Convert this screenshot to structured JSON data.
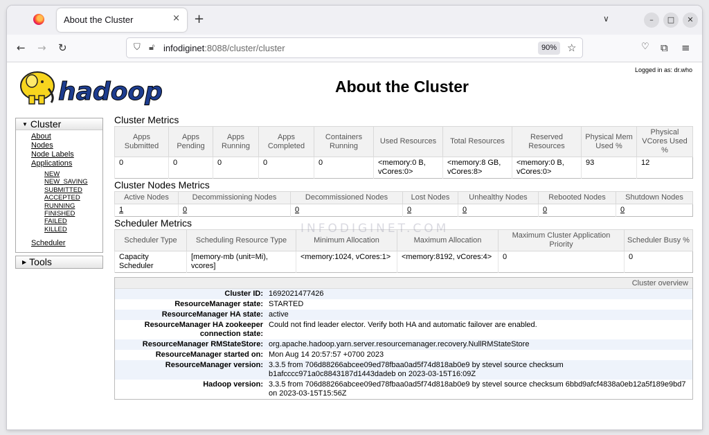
{
  "browser": {
    "tab_title": "About the Cluster",
    "tab_close": "×",
    "new_tab": "+",
    "tab_list": "∨",
    "win_minimize": "–",
    "win_maximize": "□",
    "win_close": "✕",
    "url_host": "infodiginet",
    "url_path": ":8088/cluster/cluster",
    "zoom": "90%"
  },
  "header": {
    "logo_text": "hadoop",
    "title": "About the Cluster",
    "logged_in": "Logged in as: dr.who"
  },
  "sidebar": {
    "cluster_label": "Cluster",
    "links": [
      "About",
      "Nodes",
      "Node Labels",
      "Applications"
    ],
    "app_states": [
      "NEW",
      "NEW_SAVING",
      "SUBMITTED",
      "ACCEPTED",
      "RUNNING",
      "FINISHED",
      "FAILED",
      "KILLED"
    ],
    "scheduler": "Scheduler",
    "tools_label": "Tools"
  },
  "cluster_metrics": {
    "title": "Cluster Metrics",
    "headers": [
      "Apps Submitted",
      "Apps Pending",
      "Apps Running",
      "Apps Completed",
      "Containers Running",
      "Used Resources",
      "Total Resources",
      "Reserved Resources",
      "Physical Mem Used %",
      "Physical VCores Used %"
    ],
    "values": [
      "0",
      "0",
      "0",
      "0",
      "0",
      "<memory:0 B, vCores:0>",
      "<memory:8 GB, vCores:8>",
      "<memory:0 B, vCores:0>",
      "93",
      "12"
    ]
  },
  "node_metrics": {
    "title": "Cluster Nodes Metrics",
    "headers": [
      "Active Nodes",
      "Decommissioning Nodes",
      "Decommissioned Nodes",
      "Lost Nodes",
      "Unhealthy Nodes",
      "Rebooted Nodes",
      "Shutdown Nodes"
    ],
    "values": [
      "1",
      "0",
      "0",
      "0",
      "0",
      "0",
      "0"
    ]
  },
  "scheduler_metrics": {
    "title": "Scheduler Metrics",
    "headers": [
      "Scheduler Type",
      "Scheduling Resource Type",
      "Minimum Allocation",
      "Maximum Allocation",
      "Maximum Cluster Application Priority",
      "Scheduler Busy %"
    ],
    "values": [
      "Capacity Scheduler",
      "[memory-mb (unit=Mi), vcores]",
      "<memory:1024, vCores:1>",
      "<memory:8192, vCores:4>",
      "0",
      "0"
    ]
  },
  "overview": {
    "header": "Cluster overview",
    "rows": [
      {
        "k": "Cluster ID:",
        "v": "1692021477426"
      },
      {
        "k": "ResourceManager state:",
        "v": "STARTED"
      },
      {
        "k": "ResourceManager HA state:",
        "v": "active"
      },
      {
        "k": "ResourceManager HA zookeeper connection state:",
        "v": "Could not find leader elector. Verify both HA and automatic failover are enabled."
      },
      {
        "k": "ResourceManager RMStateStore:",
        "v": "org.apache.hadoop.yarn.server.resourcemanager.recovery.NullRMStateStore"
      },
      {
        "k": "ResourceManager started on:",
        "v": "Mon Aug 14 20:57:57 +0700 2023"
      },
      {
        "k": "ResourceManager version:",
        "v": "3.3.5 from 706d88266abcee09ed78fbaa0ad5f74d818ab0e9 by stevel source checksum b1afcccc971a0c8843187d1443dadeb on 2023-03-15T16:09Z"
      },
      {
        "k": "Hadoop version:",
        "v": "3.3.5 from 706d88266abcee09ed78fbaa0ad5f74d818ab0e9 by stevel source checksum 6bbd9afcf4838a0eb12a5f189e9bd7 on 2023-03-15T15:56Z"
      }
    ]
  },
  "watermark": "INFODIGINET.COM"
}
